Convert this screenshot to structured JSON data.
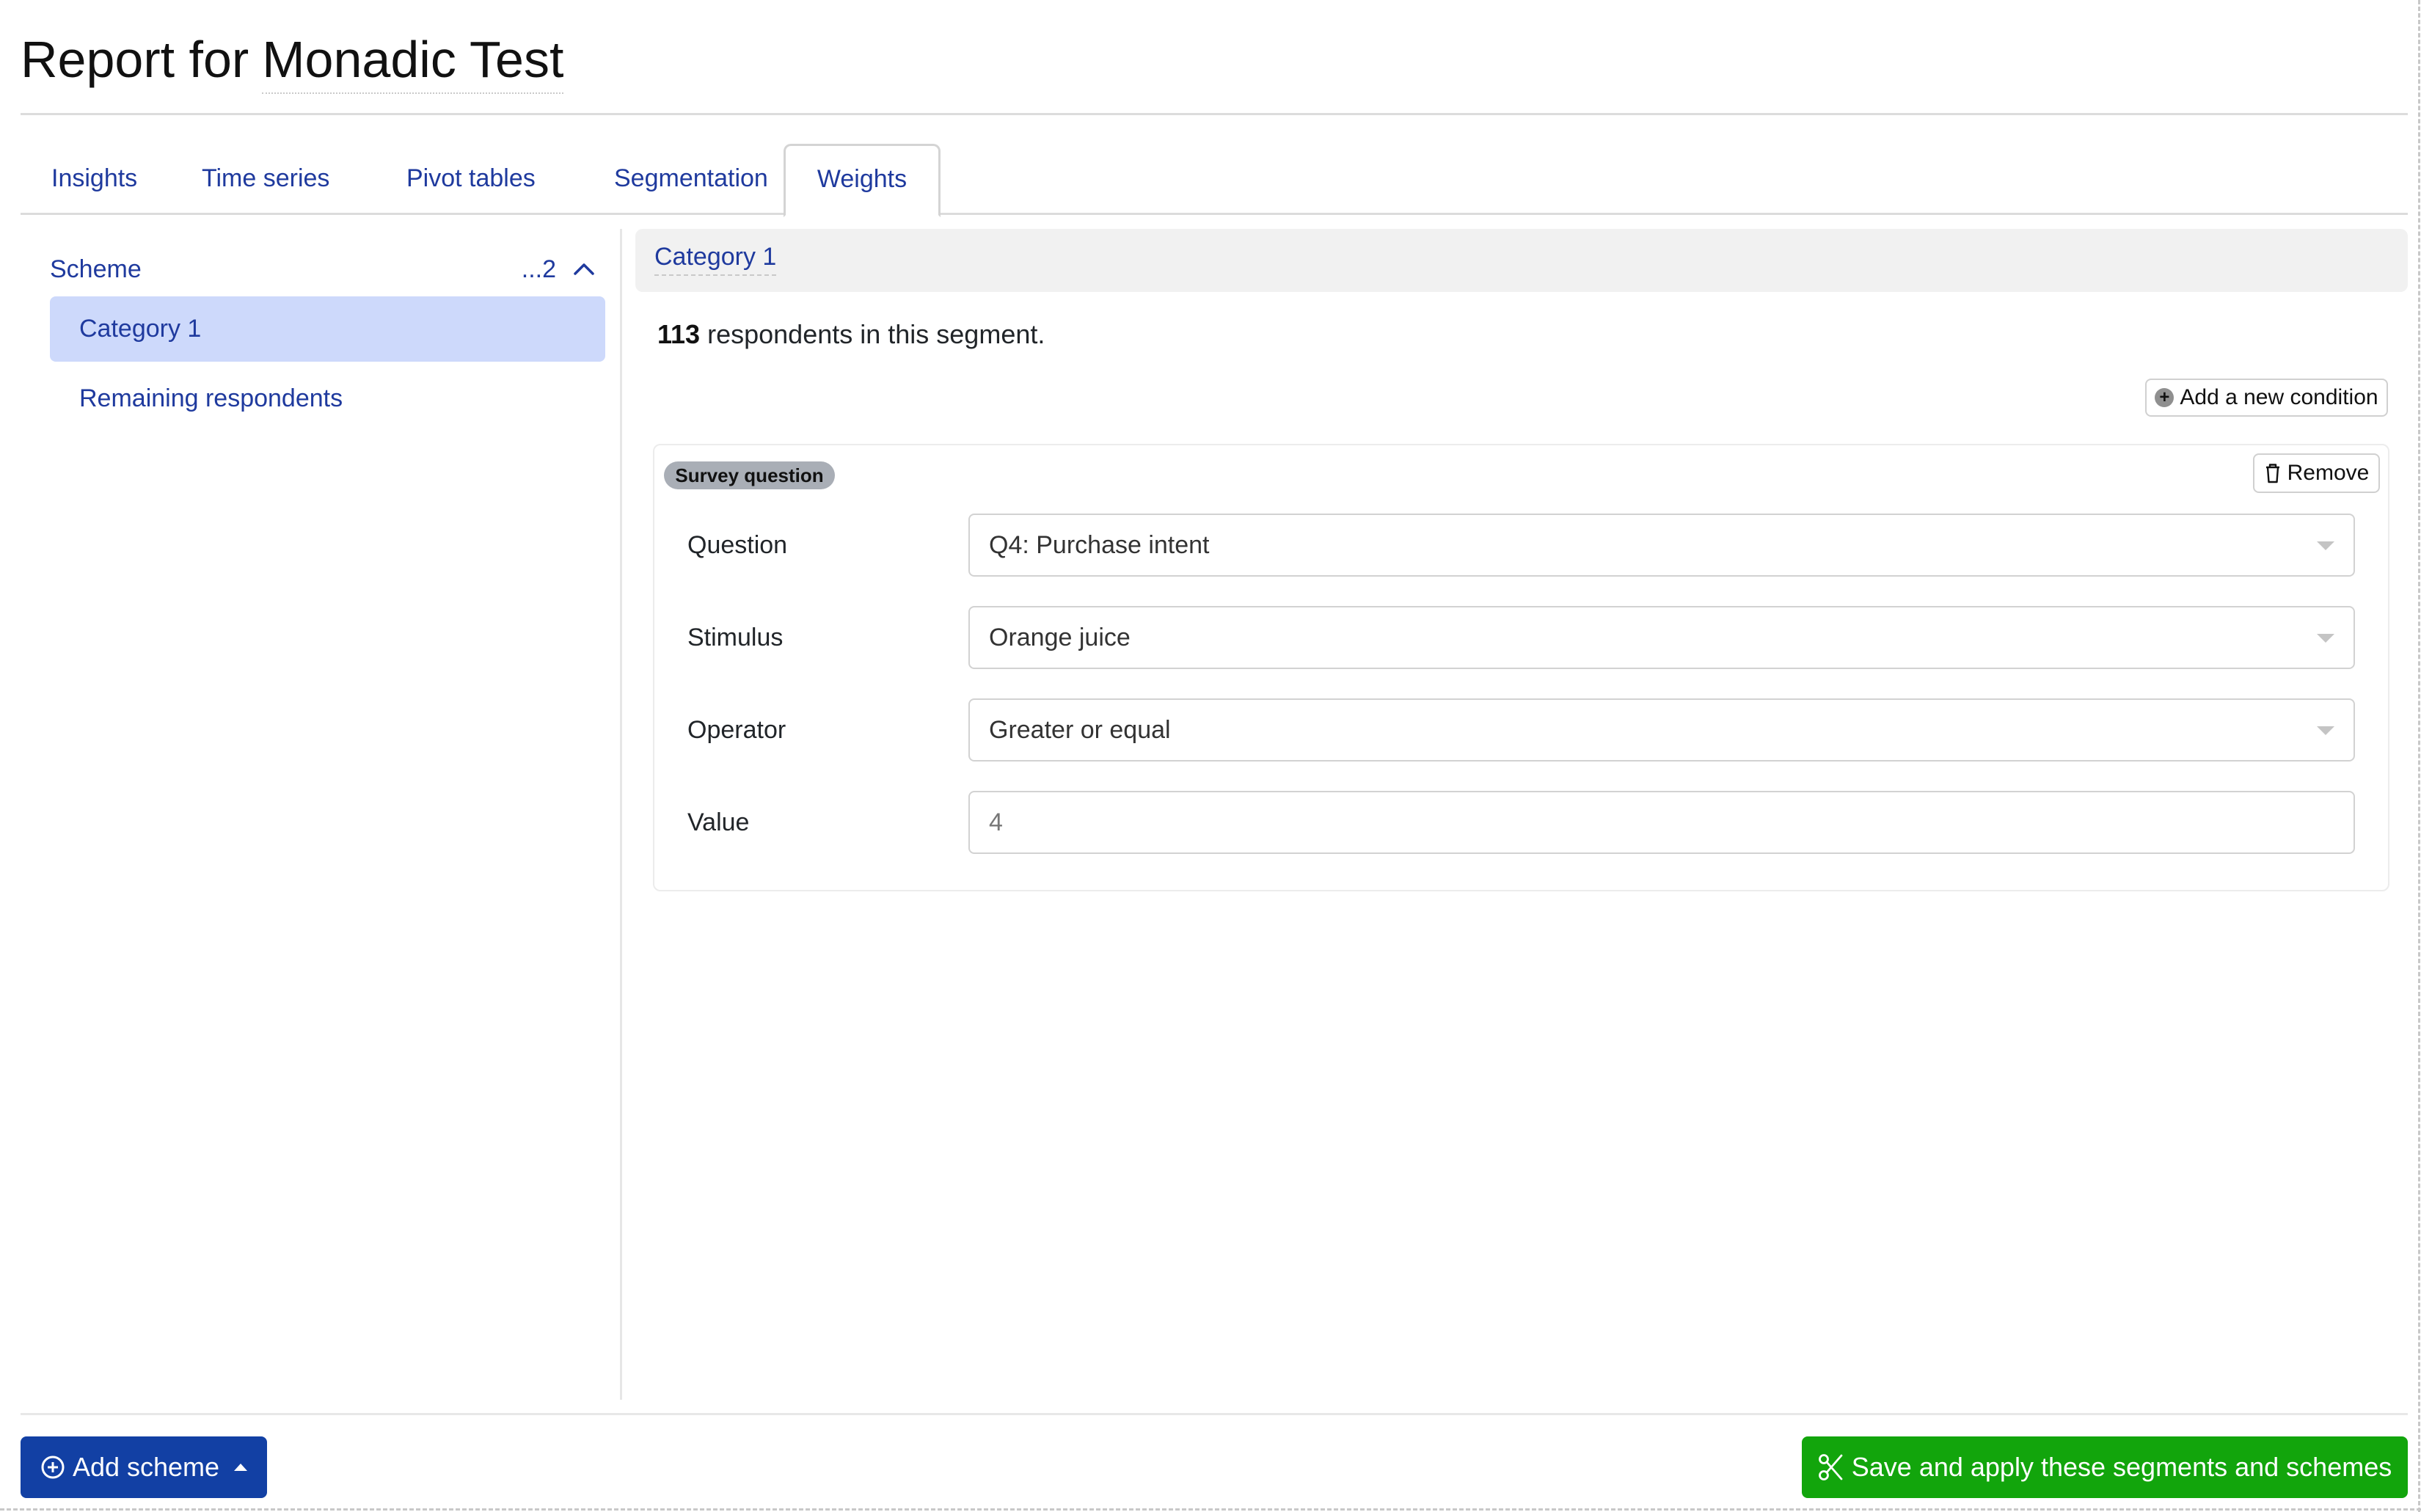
{
  "header": {
    "title_prefix": "Report for",
    "project_name": "Monadic Test"
  },
  "tabs": [
    {
      "label": "Insights",
      "active": false
    },
    {
      "label": "Time series",
      "active": false
    },
    {
      "label": "Pivot tables",
      "active": false
    },
    {
      "label": "Segmentation",
      "active": false
    },
    {
      "label": "Weights",
      "active": true
    }
  ],
  "sidebar": {
    "scheme_label": "Scheme",
    "scheme_count": "...2",
    "scheme_toggle_icon": "chevron-up-icon",
    "segments": [
      {
        "label": "Category 1",
        "active": true
      },
      {
        "label": "Remaining respondents",
        "active": false
      }
    ]
  },
  "panel": {
    "segment_name": "Category 1",
    "respondent_count": "113",
    "respondent_text": "respondents in this segment.",
    "add_condition_label": "Add a new condition",
    "add_condition_icon": "plus-circle-icon",
    "condition": {
      "type_badge": "Survey question",
      "remove_label": "Remove",
      "remove_icon": "trash-icon",
      "fields": [
        {
          "label": "Question",
          "value": "Q4: Purchase intent",
          "kind": "select"
        },
        {
          "label": "Stimulus",
          "value": "Orange juice",
          "kind": "select"
        },
        {
          "label": "Operator",
          "value": "Greater or equal",
          "kind": "select"
        },
        {
          "label": "Value",
          "value": "4",
          "kind": "input"
        }
      ]
    }
  },
  "footer": {
    "add_scheme_label": "Add scheme",
    "add_scheme_icon": "plus-circle-icon",
    "save_label": "Save and apply these segments and schemes",
    "save_icon": "scissors-icon"
  },
  "colors": {
    "link": "#1f3a9e",
    "primary": "#1240a4",
    "success": "#12a50c",
    "active_segment_bg": "#cdd9fb",
    "badge_bg": "#a9aeb6"
  }
}
